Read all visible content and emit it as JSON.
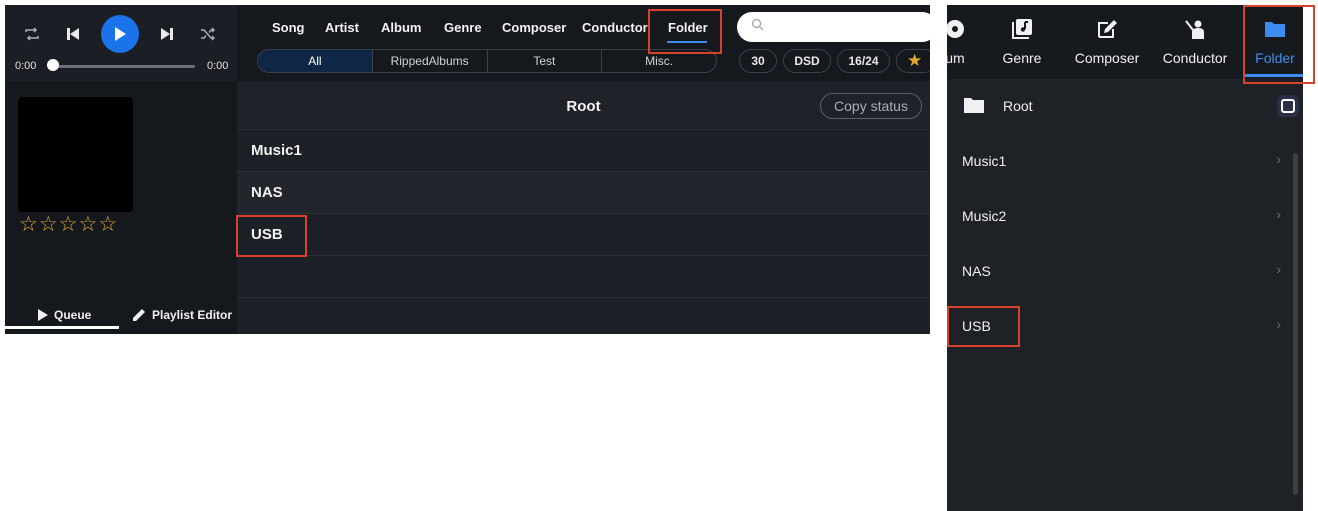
{
  "tablet": {
    "player": {
      "time_start": "0:00",
      "time_end": "0:00",
      "progress": 0,
      "rating_stars": [
        "☆",
        "☆",
        "☆",
        "☆",
        "☆"
      ],
      "icons": [
        "repeat-icon",
        "previous-icon",
        "play-icon",
        "next-icon",
        "shuffle-icon"
      ],
      "tabs": [
        {
          "label": "Queue",
          "icon": "play-icon"
        },
        {
          "label": "Playlist Editor",
          "icon": "pencil-icon"
        }
      ]
    },
    "categories": [
      "Song",
      "Artist",
      "Album",
      "Genre",
      "Composer",
      "Conductor",
      "Folder"
    ],
    "selected_category": "Folder",
    "segments": [
      "All",
      "RippedAlbums",
      "Test",
      "Misc."
    ],
    "selected_segment": "All",
    "search": {
      "placeholder": ""
    },
    "chips": [
      "30",
      "DSD",
      "16/24",
      "★"
    ],
    "root_title": "Root",
    "copy_status_label": "Copy status",
    "folders": [
      "Music1",
      "NAS",
      "USB"
    ]
  },
  "phone": {
    "tabs": [
      {
        "label": "um",
        "icon": "album-icon"
      },
      {
        "label": "Genre",
        "icon": "genre-icon"
      },
      {
        "label": "Composer",
        "icon": "composer-icon"
      },
      {
        "label": "Conductor",
        "icon": "conductor-icon"
      },
      {
        "label": "Folder",
        "icon": "folder-icon"
      }
    ],
    "selected_tab": "Folder",
    "root_label": "Root",
    "folders": [
      "Music1",
      "Music2",
      "NAS",
      "USB"
    ],
    "chevron": "›"
  },
  "colors": {
    "accent": "#1a73e8",
    "active_tab": "#3d8cf0",
    "highlight": "#d9412f",
    "star": "#e0a92e"
  }
}
